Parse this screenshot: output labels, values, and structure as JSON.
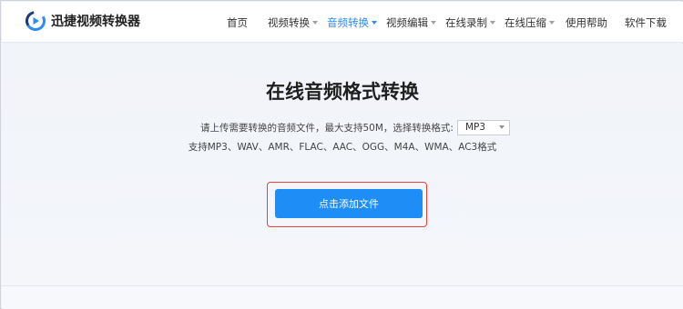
{
  "header": {
    "brand": "迅捷视频转换器",
    "nav": [
      {
        "label": "首页",
        "dropdown": false,
        "active": false
      },
      {
        "label": "视频转换",
        "dropdown": true,
        "active": false
      },
      {
        "label": "音频转换",
        "dropdown": true,
        "active": true
      },
      {
        "label": "视频编辑",
        "dropdown": true,
        "active": false
      },
      {
        "label": "在线录制",
        "dropdown": true,
        "active": false
      },
      {
        "label": "在线压缩",
        "dropdown": true,
        "active": false
      },
      {
        "label": "使用帮助",
        "dropdown": false,
        "active": false
      },
      {
        "label": "软件下载",
        "dropdown": false,
        "active": false
      }
    ]
  },
  "main": {
    "title": "在线音频格式转换",
    "description": "请上传需要转换的音频文件，最大支持50M，选择转换格式:",
    "format_select": {
      "value": "MP3"
    },
    "supported_formats": "支持MP3、WAV、AMR、FLAC、AAC、OGG、M4A、WMA、AC3格式",
    "add_button_label": "点击添加文件"
  },
  "colors": {
    "accent": "#1f8df6",
    "active_nav": "#2a8cf6",
    "highlight_border": "#e0443a",
    "background": "#f0f3f8"
  },
  "icons": {
    "logo": "brand-logo-icon",
    "caret": "chevron-down-icon"
  }
}
